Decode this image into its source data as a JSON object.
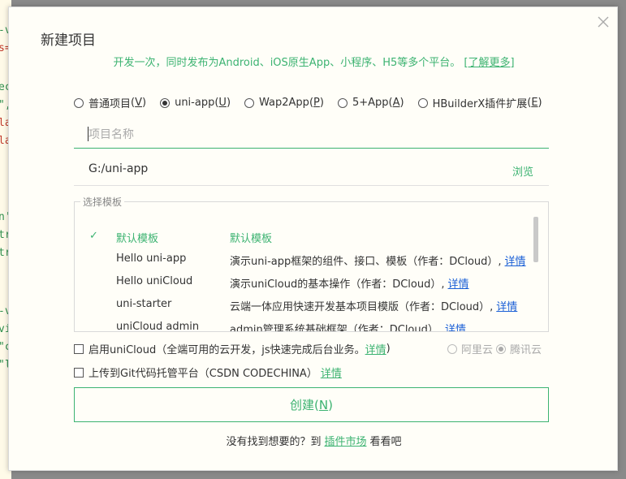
{
  "background_editor": {
    "lines": [
      {
        "text": "-v",
        "color": "green"
      },
      {
        "text": "s=",
        "color": "red"
      },
      {
        "text": "ec",
        "color": "green"
      },
      {
        "text": "\",",
        "color": "green"
      },
      {
        "text": "la",
        "color": "red"
      },
      {
        "text": "la",
        "color": "red"
      },
      {
        "text": "n'",
        "color": "green"
      },
      {
        "text": "tr",
        "color": "green"
      },
      {
        "text": "tr",
        "color": "green"
      },
      {
        "text": "-v",
        "color": "green"
      },
      {
        "text": "vi",
        "color": "green"
      },
      {
        "text": "\"c",
        "color": "green"
      },
      {
        "text": "\"l",
        "color": "green"
      }
    ]
  },
  "dialog": {
    "title": "新建项目",
    "subtitle": "开发一次，同时发布为Android、iOS原生App、小程序、H5等多个平台。",
    "learn_more": "[了解更多]",
    "close_icon": "close-icon"
  },
  "project_types": [
    {
      "label": "普通项目",
      "key": "V",
      "selected": false
    },
    {
      "label": "uni-app",
      "key": "U",
      "selected": true
    },
    {
      "label": "Wap2App",
      "key": "P",
      "selected": false
    },
    {
      "label": "5+App",
      "key": "A",
      "selected": false
    },
    {
      "label": "HBuilderX插件扩展",
      "key": "E",
      "selected": false
    }
  ],
  "project_name": {
    "value": "",
    "placeholder": "项目名称"
  },
  "location": {
    "path": "G:/uni-app",
    "browse_label": "浏览"
  },
  "templates": {
    "legend": "选择模板",
    "items": [
      {
        "name": "默认模板",
        "desc": "默认模板",
        "link": "",
        "checked": true
      },
      {
        "name": "Hello uni-app",
        "desc": "演示uni-app框架的组件、接口、模板（作者：DCloud）,",
        "link": "详情",
        "checked": false
      },
      {
        "name": "Hello uniCloud",
        "desc": "演示uniCloud的基本操作（作者：DCloud）,",
        "link": "详情",
        "checked": false
      },
      {
        "name": "uni-starter",
        "desc": "云端一体应用快速开发基本项目模版（作者：DCloud）,",
        "link": "详情",
        "checked": false
      },
      {
        "name": "uniCloud admin",
        "desc": "admin管理系统基础框架（作者：DCloud）,",
        "link": "详情",
        "checked": false
      }
    ]
  },
  "unicloud_option": {
    "label": "启用uniCloud（全端可用的云开发，js快速完成后台业务。",
    "link": "详情",
    "suffix": ")",
    "checked": false,
    "providers": [
      {
        "label": "阿里云",
        "selected": false
      },
      {
        "label": "腾讯云",
        "selected": true
      }
    ]
  },
  "git_option": {
    "label": "上传到Git代码托管平台（CSDN CODECHINA）",
    "link": "详情",
    "checked": false
  },
  "create_button": {
    "label": "创建",
    "key": "N"
  },
  "footer": {
    "prefix": "没有找到想要的？到",
    "link": "插件市场",
    "suffix": "看看吧"
  },
  "colors": {
    "accent": "#3cb371",
    "link_blue": "#1a5fd6",
    "dialog_bg": "#fffef8"
  }
}
